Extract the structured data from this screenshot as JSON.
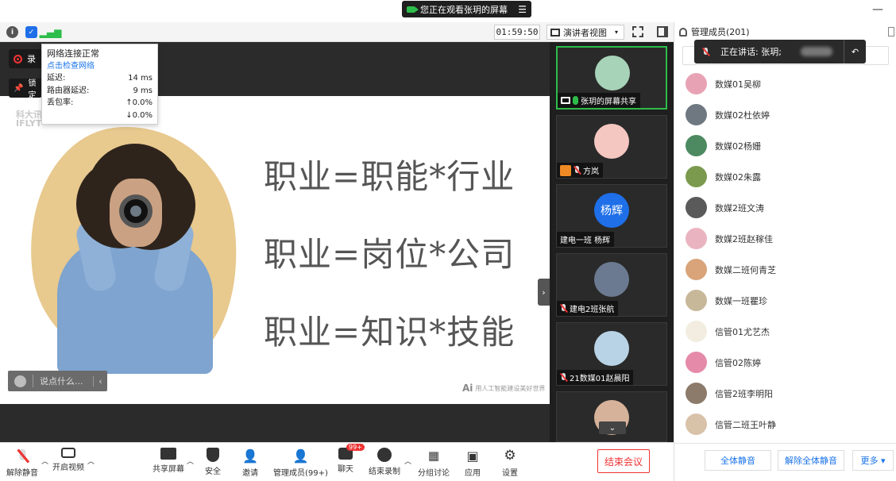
{
  "window": {
    "viewing_text": "您正在观看张玥的屏幕",
    "minimize_label": "—"
  },
  "topbar": {
    "timer": "01:59:50",
    "view_mode": "演讲者视图"
  },
  "network_popup": {
    "title": "网络连接正常",
    "check_link": "点击检查网络",
    "rows": [
      {
        "label": "延迟:",
        "value": "14 ms"
      },
      {
        "label": "路由器延迟:",
        "value": "9 ms"
      },
      {
        "label": "丢包率:",
        "value": "↑0.0%"
      },
      {
        "label": "",
        "value": "↓0.0%"
      }
    ]
  },
  "overlay_buttons": {
    "record_label": "录",
    "lock_label": "锁定"
  },
  "slide": {
    "logo_line1": "科大讯",
    "logo_line2": "IFLYT",
    "lines": [
      "职业=职能*行业",
      "职业=岗位*公司",
      "职业=知识*技能"
    ],
    "footer_mark": "Ai",
    "footer_text": "用人工智能建设美好世界"
  },
  "chat_input": {
    "placeholder": "说点什么...",
    "chevron": "‹"
  },
  "video_tiles": [
    {
      "name": "张玥的屏幕共享",
      "avatar_color": "#a7d3b8",
      "status": "screen",
      "avatar_text": ""
    },
    {
      "name": "方岚",
      "avatar_color": "#f4c7c0",
      "status": "host",
      "avatar_text": ""
    },
    {
      "name": "建电一班 杨辉",
      "avatar_color": "#1e6fe8",
      "status": "none",
      "avatar_text": "杨辉"
    },
    {
      "name": "建电2班张航",
      "avatar_color": "#6b7a90",
      "status": "muted",
      "avatar_text": ""
    },
    {
      "name": "21数媒01赵晨阳",
      "avatar_color": "#b9d3e6",
      "status": "muted",
      "avatar_text": ""
    },
    {
      "name": "",
      "avatar_color": "#d6b29a",
      "status": "muted",
      "avatar_text": ""
    }
  ],
  "panel": {
    "title": "管理成员(201)",
    "speaking_prefix": "正在讲话: 张玥;",
    "members": [
      {
        "name": "数媒01吴柳",
        "color": "#e7a3b4"
      },
      {
        "name": "数媒02杜依婷",
        "color": "#6f7880"
      },
      {
        "name": "数媒02杨姗",
        "color": "#4d8a62"
      },
      {
        "name": "数媒02朱露",
        "color": "#7b9a4e"
      },
      {
        "name": "数媒2班文涛",
        "color": "#5a5a5a"
      },
      {
        "name": "数媒2班赵稼佳",
        "color": "#e9b4c0"
      },
      {
        "name": "数媒二班何青芝",
        "color": "#d9a47a"
      },
      {
        "name": "数媒一班瞿珍",
        "color": "#c8b89a"
      },
      {
        "name": "信管01尤艺杰",
        "color": "#f2ede0"
      },
      {
        "name": "信管02陈婷",
        "color": "#e58aa8"
      },
      {
        "name": "信管2班李明阳",
        "color": "#8c7a6a"
      },
      {
        "name": "信管二班王叶静",
        "color": "#d8c2a8"
      }
    ],
    "mute_all": "全体静音",
    "unmute_all": "解除全体静音",
    "more": "更多 ▾"
  },
  "controls": {
    "unmute": "解除静音",
    "start_video": "开启视频",
    "share_screen": "共享屏幕",
    "security": "安全",
    "invite": "邀请",
    "manage_members": "管理成员(99+)",
    "chat": "聊天",
    "chat_badge": "99+",
    "end_record": "结束录制",
    "breakout": "分组讨论",
    "apps": "应用",
    "settings": "设置",
    "end_meeting": "结束会议"
  },
  "colors": {
    "accent_green": "#2dbd4a",
    "link_blue": "#1a73e8",
    "danger_red": "#e33333"
  }
}
